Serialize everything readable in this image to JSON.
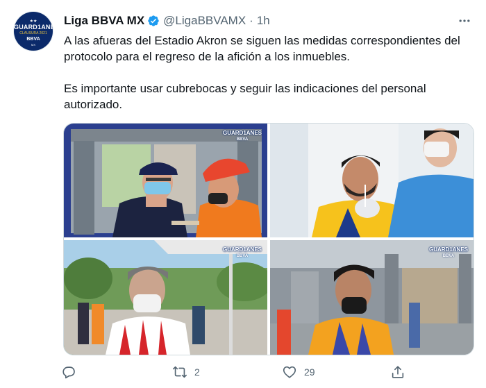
{
  "account": {
    "display_name": "Liga BBVA MX",
    "handle": "@LigaBBVAMX",
    "separator": "·",
    "time": "1h",
    "verified": true,
    "avatar": {
      "top_text": "★★",
      "title": "GUARD1ANES",
      "subtitle": "CLAUSURA 2021",
      "brand": "BBVA",
      "suffix": "MX"
    }
  },
  "tweet": {
    "paragraphs": [
      "A las afueras del Estadio Akron se siguen las medidas correspondientes del protocolo para el regreso de la afición a los inmuebles.",
      "Es importante usar cubrebocas y seguir las indicaciones del personal autorizado."
    ]
  },
  "media": {
    "watermark_title": "GUARD1ANES",
    "watermark_brand": "BBVA",
    "photos": [
      "photo-security-check",
      "photo-nasal-swab-test",
      "photo-fan-check-tent",
      "photo-fan-metal-detector"
    ]
  },
  "actions": {
    "reply_count": "",
    "retweet_count": "2",
    "like_count": "29",
    "share_count": ""
  },
  "icons": [
    "verified-badge-icon",
    "more-icon",
    "reply-icon",
    "retweet-icon",
    "like-icon",
    "share-icon"
  ],
  "colors": {
    "text": "#0f1419",
    "secondary": "#536471",
    "verified": "#1d9bf0",
    "border": "#cfd9de",
    "brand_navy": "#0b2a6a"
  }
}
